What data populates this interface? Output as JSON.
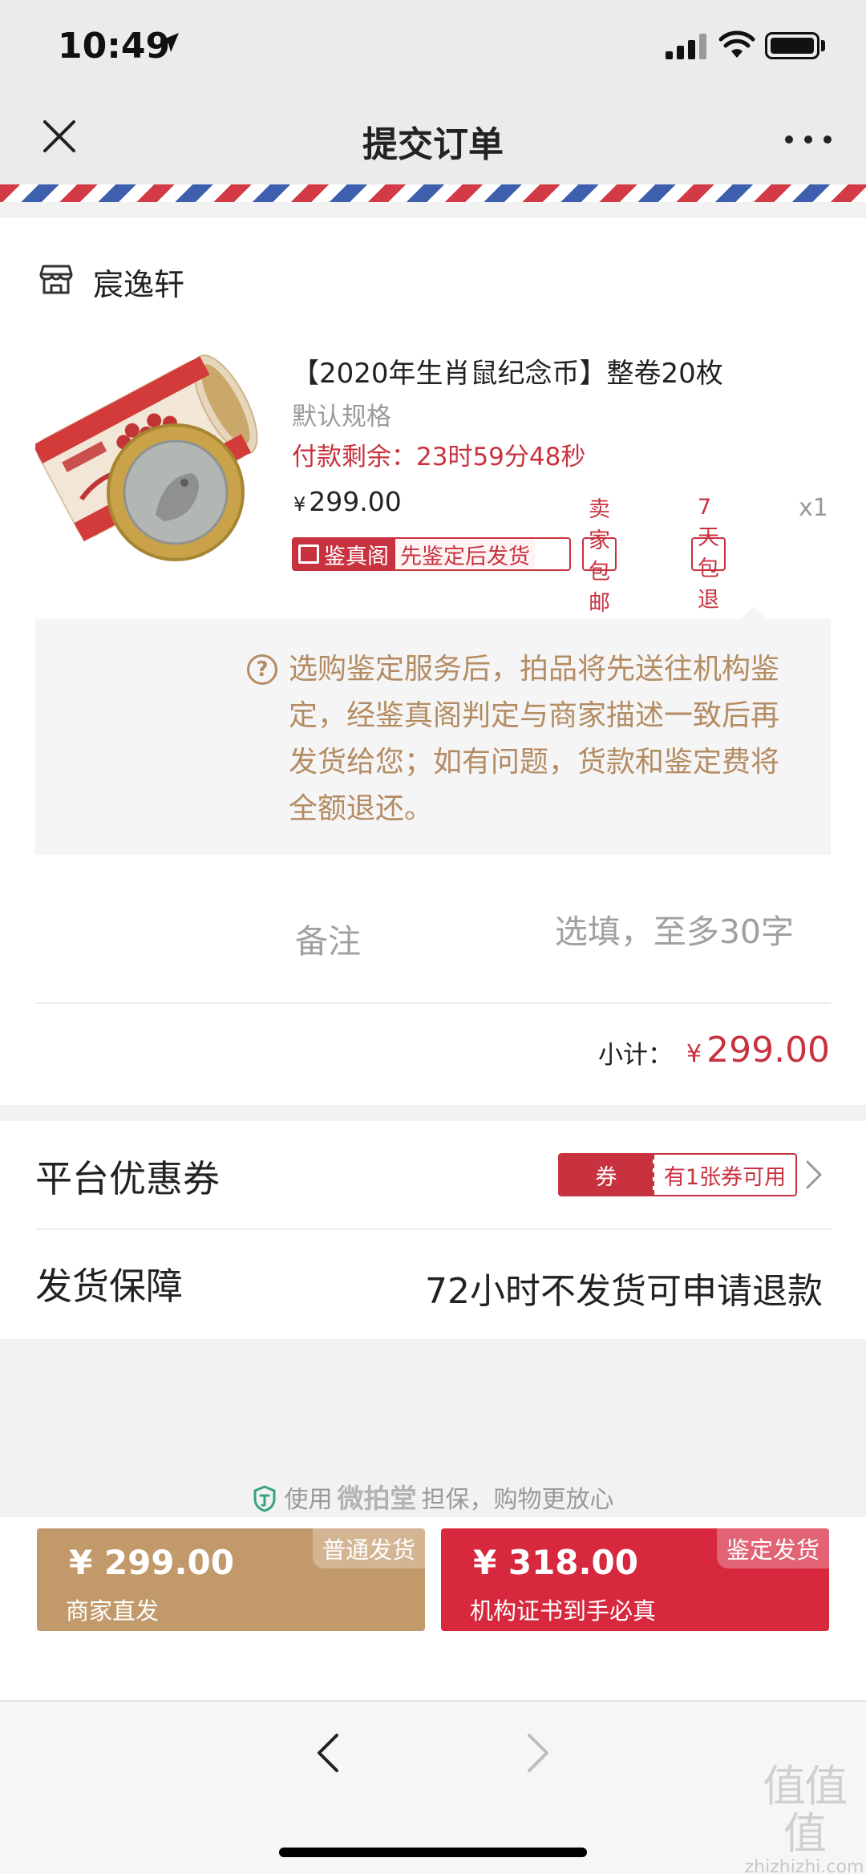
{
  "status_bar": {
    "time": "10:49"
  },
  "nav": {
    "title": "提交订单"
  },
  "shop": {
    "name": "宸逸轩"
  },
  "product": {
    "title": "【2020年生肖鼠纪念币】整卷20枚",
    "spec": "默认规格",
    "countdown": "付款剩余：23时59分48秒",
    "currency": "¥",
    "price": "299.00",
    "quantity": "x1",
    "tags": {
      "jzg_brand": "鉴真阁",
      "jzg_text": "先鉴定后发货",
      "free_shipping": "卖家包邮",
      "return_policy": "7天包退"
    }
  },
  "notice": {
    "icon": "?",
    "text": "选购鉴定服务后，拍品将先送往机构鉴定，经鉴真阁判定与商家描述一致后再发货给您；如有问题，货款和鉴定费将全额退还。"
  },
  "remark": {
    "label": "备注",
    "placeholder": "选填，至多30字"
  },
  "subtotal": {
    "label": "小计：",
    "currency": "¥",
    "value": "299.00"
  },
  "coupon": {
    "label": "平台优惠券",
    "tag": "券",
    "available": "有1张券可用"
  },
  "guarantee": {
    "label": "发货保障",
    "value": "72小时不发货可申请退款"
  },
  "secure": {
    "prefix": "使用",
    "brand": "微拍堂",
    "suffix": "担保，购物更放心"
  },
  "buttons": {
    "normal": {
      "amount": "¥ 299.00",
      "sub": "商家直发",
      "corner": "普通发货"
    },
    "appraise": {
      "amount": "¥ 318.00",
      "sub": "机构证书到手必真",
      "corner": "鉴定发货"
    }
  },
  "watermark": {
    "big": "值值值",
    "small": "zhizhizhi.com"
  },
  "colors": {
    "accent_red": "#c8323f",
    "button_gold": "#c2996b",
    "button_red": "#d7283d",
    "notice_text": "#b48c63"
  }
}
